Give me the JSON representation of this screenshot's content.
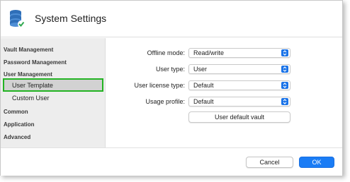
{
  "window": {
    "title": "System Settings",
    "app_icon": "database-check-icon"
  },
  "sidebar": {
    "items": [
      {
        "label": "Vault Management",
        "type": "section"
      },
      {
        "label": "Password Management",
        "type": "section"
      },
      {
        "label": "User Management",
        "type": "section"
      },
      {
        "label": "User Template",
        "type": "subitem",
        "selected": true
      },
      {
        "label": "Custom User",
        "type": "subitem"
      },
      {
        "label": "Common",
        "type": "section"
      },
      {
        "label": "Application",
        "type": "section"
      },
      {
        "label": "Advanced",
        "type": "section"
      }
    ],
    "selected_highlight_color": "#22b322"
  },
  "form": {
    "fields": [
      {
        "label": "Offline mode:",
        "value": "Read/write"
      },
      {
        "label": "User type:",
        "value": "User"
      },
      {
        "label": "User license type:",
        "value": "Default"
      },
      {
        "label": "Usage profile:",
        "value": "Default"
      }
    ],
    "vault_button_label": "User default vault"
  },
  "footer": {
    "cancel_label": "Cancel",
    "ok_label": "OK"
  },
  "colors": {
    "accent": "#1a7cf5",
    "sidebar_bg": "#ededed"
  }
}
